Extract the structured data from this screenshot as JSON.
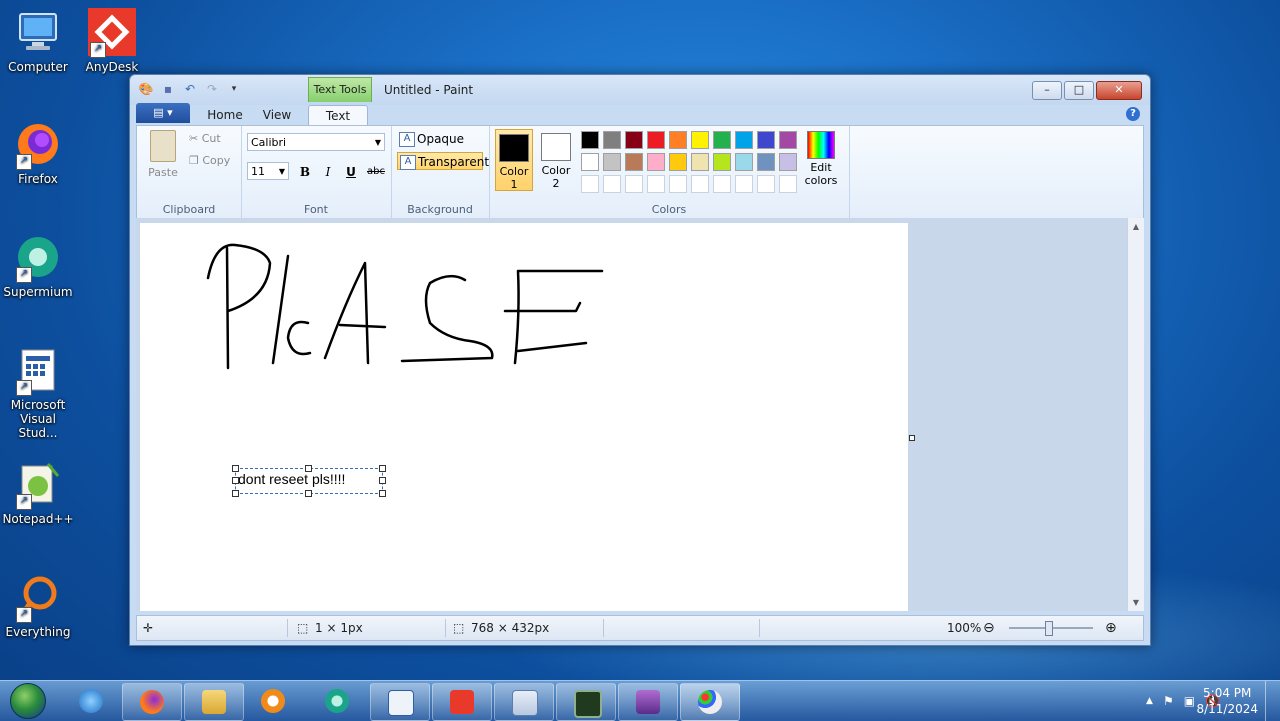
{
  "desktop": {
    "icons": [
      {
        "label": "Computer"
      },
      {
        "label": "AnyDesk"
      },
      {
        "label": "Firefox"
      },
      {
        "label": "Supermium"
      },
      {
        "label": "Microsoft Visual Stud..."
      },
      {
        "label": "Notepad++"
      },
      {
        "label": "Everything"
      }
    ]
  },
  "window": {
    "title": "Untitled - Paint",
    "contextual_tab": "Text Tools",
    "tabs": [
      {
        "label": "Home"
      },
      {
        "label": "View"
      },
      {
        "label": "Text"
      }
    ],
    "active_tab": "Text"
  },
  "ribbon": {
    "clipboard": {
      "paste": "Paste",
      "cut": "Cut",
      "copy": "Copy",
      "label": "Clipboard"
    },
    "font": {
      "family": "Calibri",
      "size": "11",
      "bold": "B",
      "italic": "I",
      "underline": "U",
      "strike": "abc",
      "label": "Font"
    },
    "background": {
      "opaque": "Opaque",
      "transparent": "Transparent",
      "selected": "Transparent",
      "label": "Background"
    },
    "colors": {
      "color1_label": "Color 1",
      "color2_label": "Color 2",
      "color1": "#000000",
      "color2": "#ffffff",
      "edit_label": "Edit colors",
      "label": "Colors",
      "palette": [
        "#000000",
        "#7f7f7f",
        "#880015",
        "#ed1c24",
        "#ff7f27",
        "#fff200",
        "#22b14c",
        "#00a2e8",
        "#3f48cc",
        "#a349a4",
        "#ffffff",
        "#c3c3c3",
        "#b97a57",
        "#ffaec9",
        "#ffc90e",
        "#efe4b0",
        "#b5e61d",
        "#99d9ea",
        "#7092be",
        "#c8bfe7",
        "#ffffff",
        "#ffffff",
        "#ffffff",
        "#ffffff",
        "#ffffff",
        "#ffffff",
        "#ffffff",
        "#ffffff",
        "#ffffff",
        "#ffffff"
      ]
    }
  },
  "canvas": {
    "text_box_value": "dont reseet pls!!!!"
  },
  "status": {
    "cursor_pos": "",
    "selection_size": "1 × 1px",
    "canvas_size": "768 × 432px",
    "zoom": "100%"
  },
  "taskbar": {
    "time": "5:04 PM",
    "date": "8/11/2024"
  }
}
